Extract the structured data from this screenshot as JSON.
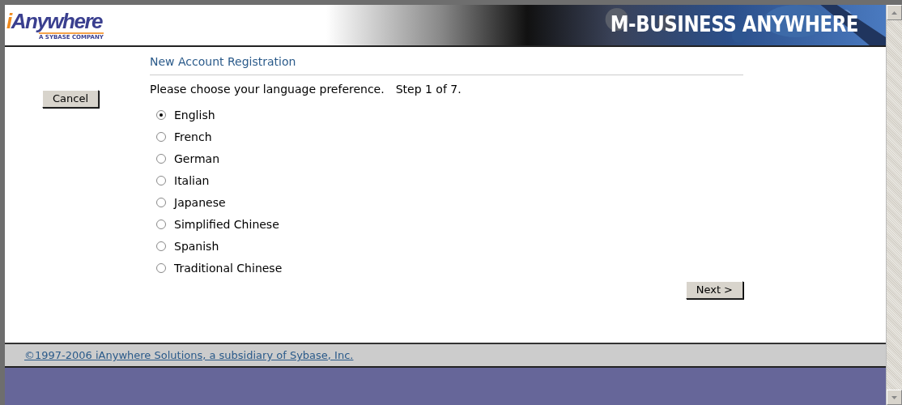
{
  "header": {
    "logo_parts": [
      "i",
      "Anywhere"
    ],
    "logo_tagline": "A SYBASE COMPANY",
    "banner_title": "M-BUSINESS ANYWHERE"
  },
  "form": {
    "title": "New Account Registration",
    "cancel_button": "Cancel",
    "prompt": "Please choose your language preference.",
    "step": "Step 1 of 7.",
    "languages": [
      {
        "label": "English",
        "selected": true
      },
      {
        "label": "French",
        "selected": false
      },
      {
        "label": "German",
        "selected": false
      },
      {
        "label": "Italian",
        "selected": false
      },
      {
        "label": "Japanese",
        "selected": false
      },
      {
        "label": "Simplified Chinese",
        "selected": false
      },
      {
        "label": "Spanish",
        "selected": false
      },
      {
        "label": "Traditional Chinese",
        "selected": false
      }
    ],
    "next_button": "Next >"
  },
  "footer": {
    "copyright_link": "©1997-2006 iAnywhere Solutions, a subsidiary of Sybase, Inc."
  }
}
